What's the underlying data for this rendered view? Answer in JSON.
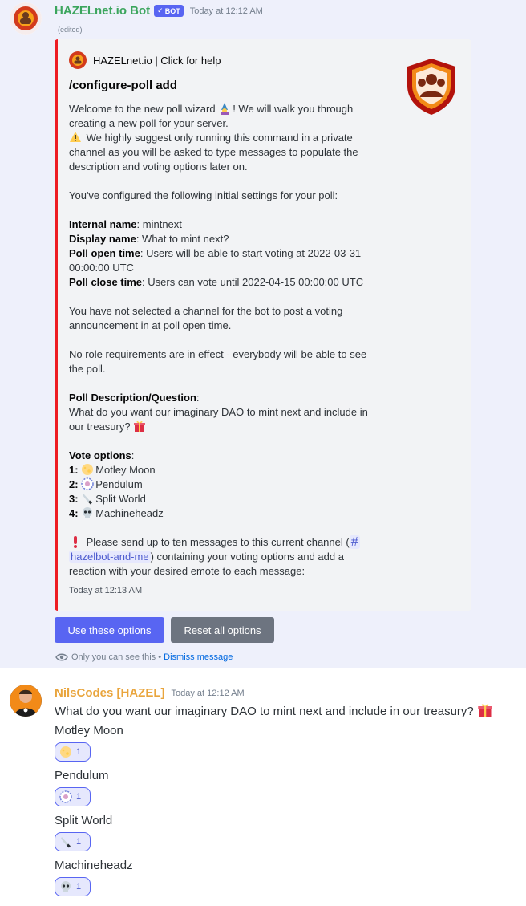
{
  "bot_message": {
    "author": "HAZELnet.io Bot",
    "tag": "BOT",
    "timestamp": "Today at 12:12 AM",
    "edited": "(edited)",
    "embed": {
      "author_name": "HAZELnet.io | Click for help",
      "title": "/configure-poll add",
      "accent_color": "#ed1c24",
      "lines": {
        "intro1a": "Welcome to the new poll wizard ",
        "intro1b": "! We will walk you through",
        "intro2": "creating a new poll for your server.",
        "warn1": " We highly suggest only running this command in a private",
        "warn2": "channel as you will be asked to type messages to populate the",
        "warn3": "description and voting options later on.",
        "configured": "You've configured the following initial settings for your poll:",
        "internal_label": "Internal name",
        "internal_value": ": mintnext",
        "display_label": "Display name",
        "display_value": ": What to mint next?",
        "open_label": "Poll open time",
        "open_value1": ": Users will be able to start voting at 2022-03-31",
        "open_value2": "00:00:00 UTC",
        "close_label": "Poll close time",
        "close_value": ": Users can vote until 2022-04-15 00:00:00 UTC",
        "channel1": "You have not selected a channel for the bot to post a voting",
        "channel2": "announcement in at poll open time.",
        "role1": "No role requirements are in effect - everybody will be able to see",
        "role2": "the poll.",
        "desc_label": "Poll Description/Question",
        "desc_colon": ":",
        "desc1": "What do you want our imaginary DAO to mint next and include in",
        "desc2": "our treasury? ",
        "vote_label": "Vote options",
        "vote_colon": ":",
        "send1": " Please send up to ten messages to this current channel (",
        "send_mention_hash": "#",
        "send_mention": "hazelbot-and-me",
        "send2": ") containing your voting options and add a",
        "send3": "reaction with your desired emote to each message:"
      },
      "options": [
        {
          "num": "1:",
          "name": "Motley Moon",
          "icon": "moon-emoji"
        },
        {
          "num": "2:",
          "name": "Pendulum",
          "icon": "pendulum-emoji"
        },
        {
          "num": "3:",
          "name": "Split World",
          "icon": "knife-emoji"
        },
        {
          "num": "4:",
          "name": "Machineheadz",
          "icon": "skull-emoji"
        }
      ],
      "footer": "Today at 12:13 AM"
    },
    "buttons": {
      "use": "Use these options",
      "reset": "Reset all options"
    },
    "ephemeral": {
      "text": "Only you can see this • ",
      "dismiss": "Dismiss message"
    }
  },
  "user_message": {
    "author": "NilsCodes [HAZEL]",
    "timestamp": "Today at 12:12 AM",
    "question": "What do you want our imaginary DAO to mint next and include in our treasury? ",
    "options": [
      {
        "text": "Motley Moon",
        "reaction_count": "1"
      },
      {
        "text": "Pendulum",
        "reaction_count": "1"
      },
      {
        "text": "Split World",
        "reaction_count": "1"
      },
      {
        "text": "Machineheadz",
        "reaction_count": "1"
      }
    ]
  }
}
